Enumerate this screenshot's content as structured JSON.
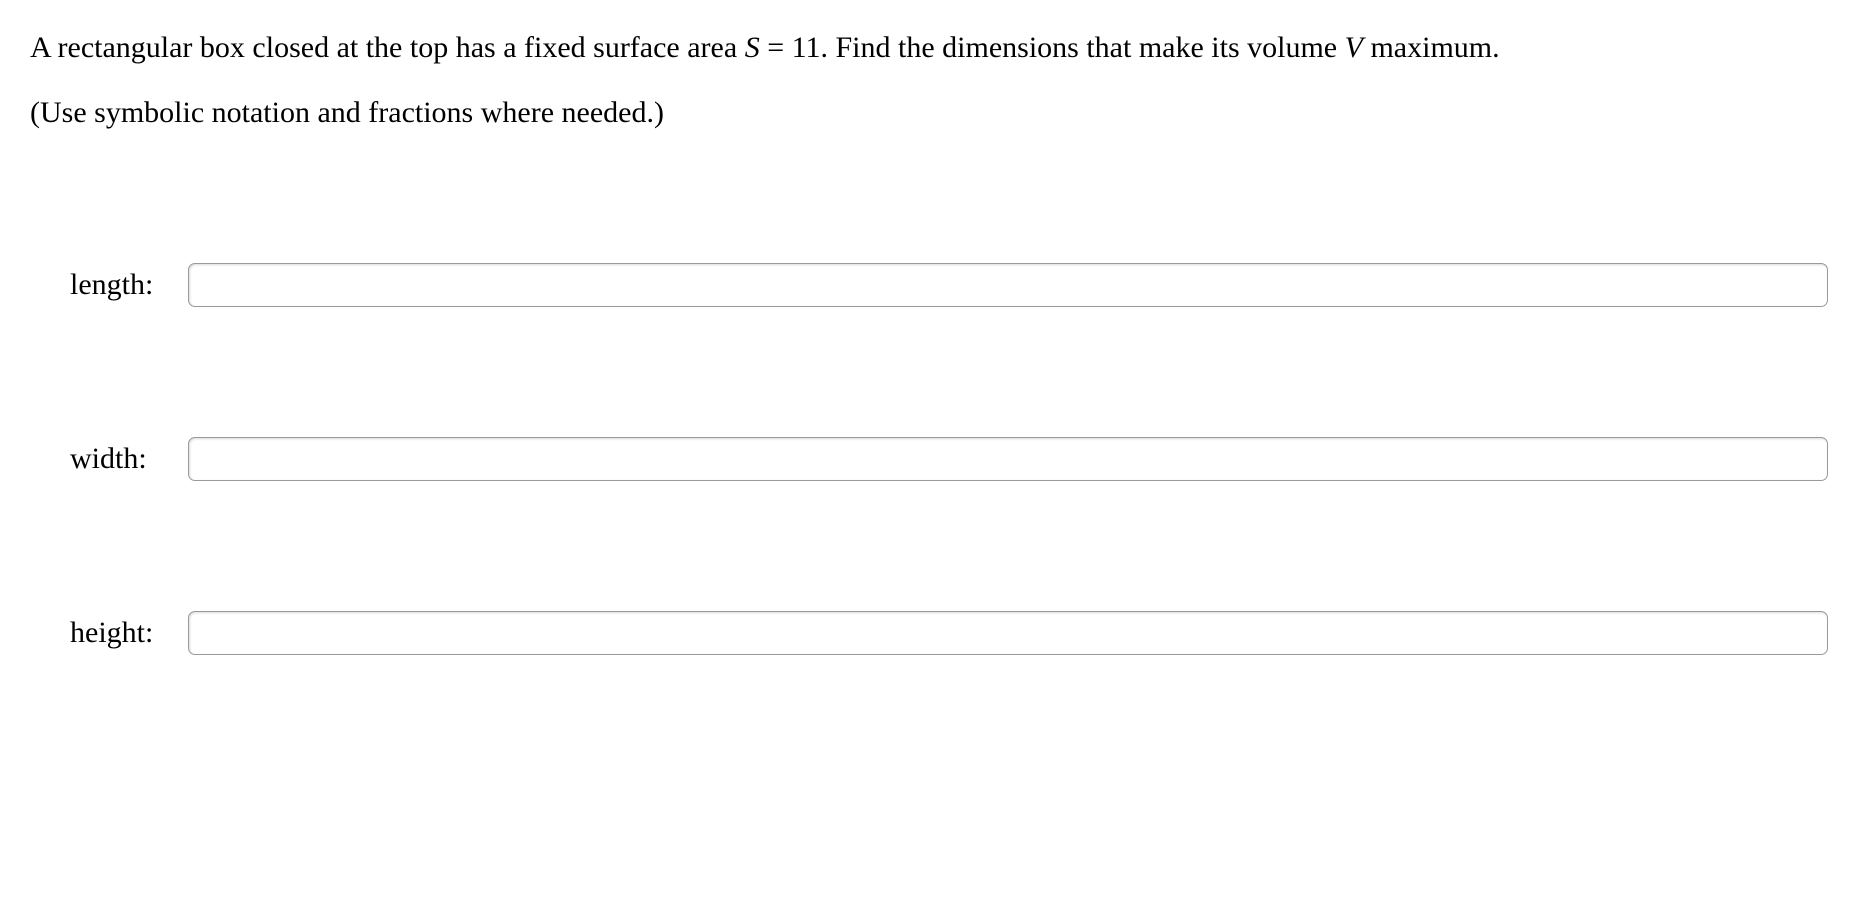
{
  "problem": {
    "text_before_S": "A rectangular box closed at the top has a fixed surface area ",
    "var_S": "S",
    "equals": " = ",
    "S_value": "11",
    "text_after_S": ". Find the dimensions that make its volume ",
    "var_V": "V",
    "text_end": " maximum."
  },
  "hint": "(Use symbolic notation and fractions where needed.)",
  "answers": {
    "length_label": "length:",
    "width_label": "width:",
    "height_label": "height:",
    "length_value": "",
    "width_value": "",
    "height_value": ""
  }
}
